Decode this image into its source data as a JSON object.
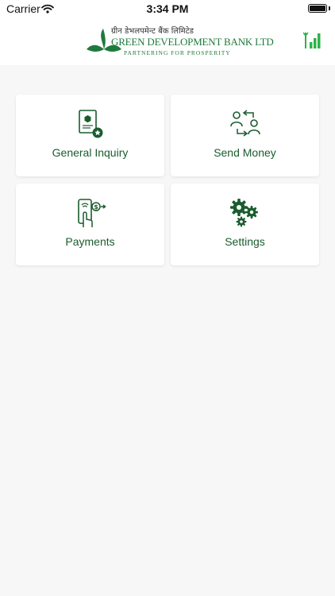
{
  "status_bar": {
    "carrier": "Carrier",
    "time": "3:34 PM"
  },
  "header": {
    "logo_devanagari": "ग्रीन डेभलपमेन्ट बैंक लिमिटेड",
    "logo_name": "GREEN DEVELOPMENT BANK LTD",
    "logo_tagline": "PARTNERING FOR PROSPERITY",
    "signal_icon": "signal-strength-icon"
  },
  "menu": [
    {
      "label": "General Inquiry",
      "icon": "inquiry-document-icon"
    },
    {
      "label": "Send Money",
      "icon": "send-money-transfer-icon"
    },
    {
      "label": "Payments",
      "icon": "mobile-payment-icon"
    },
    {
      "label": "Settings",
      "icon": "settings-gears-icon"
    }
  ],
  "colors": {
    "brand_green": "#1f7a3c",
    "label_green": "#1a5c2e",
    "background": "#f7f7f7"
  }
}
